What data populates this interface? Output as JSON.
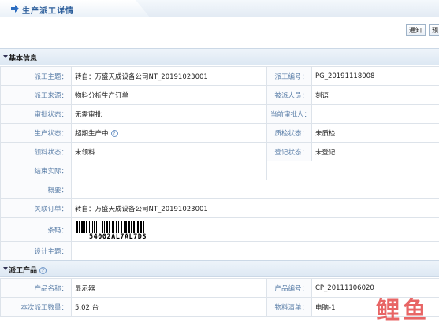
{
  "window": {
    "title": "生产派工详情"
  },
  "toolbar": {
    "notify_label": "通知",
    "second_label": "预"
  },
  "basic_section": {
    "title": "基本信息",
    "rows": [
      [
        {
          "label": "派工主题：",
          "value": "转自：万盛天成设备公司NT_20191023001"
        },
        {
          "label": "派工编号：",
          "value": "PG_20191118008"
        }
      ],
      [
        {
          "label": "派工来源：",
          "value": "物料分析生产订单"
        },
        {
          "label": "被派人员：",
          "value": "刻语"
        }
      ],
      [
        {
          "label": "审批状态：",
          "value": "无需审批"
        },
        {
          "label": "当前审批人：",
          "value": ""
        }
      ],
      [
        {
          "label": "生产状态：",
          "value": "超期生产中"
        },
        {
          "label": "质检状态：",
          "value": "未质检"
        }
      ],
      [
        {
          "label": "领料状态：",
          "value": "未领料"
        },
        {
          "label": "登记状态：",
          "value": "未登记"
        }
      ]
    ],
    "end_date_label": "结束实际：",
    "summary_label": "概要：",
    "order_label": "关联订单：",
    "order_value": "转自：万盛天成设备公司NT_20191023001",
    "barcode_label": "条码：",
    "barcode_value": "54002AL7AL7DS",
    "design_label": "设计主题："
  },
  "product_section": {
    "title": "派工产品",
    "rows": [
      [
        {
          "label": "产品名称：",
          "value": "显示器"
        },
        {
          "label": "产品编号：",
          "value": "CP_20111106020"
        }
      ],
      [
        {
          "label": "本次派工数量：",
          "value": "5.02 台"
        },
        {
          "label": "物料清单：",
          "value": "电脑-1"
        }
      ]
    ]
  },
  "watermark": {
    "text": "鲤鱼"
  },
  "colors": {
    "label": "#5a7ea8",
    "title": "#2b5d9a",
    "watermark": "#e23b3b"
  }
}
